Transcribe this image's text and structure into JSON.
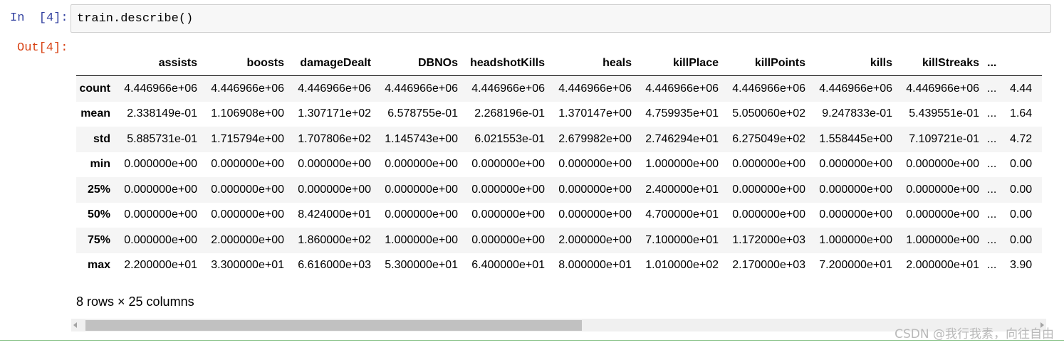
{
  "input_cell": {
    "prompt": "In  [4]:",
    "code": "train.describe()"
  },
  "output_cell": {
    "prompt": "Out[4]:"
  },
  "table": {
    "columns": [
      "assists",
      "boosts",
      "damageDealt",
      "DBNOs",
      "headshotKills",
      "heals",
      "killPlace",
      "killPoints",
      "kills",
      "killStreaks",
      "..."
    ],
    "rows": [
      {
        "index": "count",
        "values": [
          "4.446966e+06",
          "4.446966e+06",
          "4.446966e+06",
          "4.446966e+06",
          "4.446966e+06",
          "4.446966e+06",
          "4.446966e+06",
          "4.446966e+06",
          "4.446966e+06",
          "4.446966e+06",
          "...",
          "4.44"
        ]
      },
      {
        "index": "mean",
        "values": [
          "2.338149e-01",
          "1.106908e+00",
          "1.307171e+02",
          "6.578755e-01",
          "2.268196e-01",
          "1.370147e+00",
          "4.759935e+01",
          "5.050060e+02",
          "9.247833e-01",
          "5.439551e-01",
          "...",
          "1.64"
        ]
      },
      {
        "index": "std",
        "values": [
          "5.885731e-01",
          "1.715794e+00",
          "1.707806e+02",
          "1.145743e+00",
          "6.021553e-01",
          "2.679982e+00",
          "2.746294e+01",
          "6.275049e+02",
          "1.558445e+00",
          "7.109721e-01",
          "...",
          "4.72"
        ]
      },
      {
        "index": "min",
        "values": [
          "0.000000e+00",
          "0.000000e+00",
          "0.000000e+00",
          "0.000000e+00",
          "0.000000e+00",
          "0.000000e+00",
          "1.000000e+00",
          "0.000000e+00",
          "0.000000e+00",
          "0.000000e+00",
          "...",
          "0.00"
        ]
      },
      {
        "index": "25%",
        "values": [
          "0.000000e+00",
          "0.000000e+00",
          "0.000000e+00",
          "0.000000e+00",
          "0.000000e+00",
          "0.000000e+00",
          "2.400000e+01",
          "0.000000e+00",
          "0.000000e+00",
          "0.000000e+00",
          "...",
          "0.00"
        ]
      },
      {
        "index": "50%",
        "values": [
          "0.000000e+00",
          "0.000000e+00",
          "8.424000e+01",
          "0.000000e+00",
          "0.000000e+00",
          "0.000000e+00",
          "4.700000e+01",
          "0.000000e+00",
          "0.000000e+00",
          "0.000000e+00",
          "...",
          "0.00"
        ]
      },
      {
        "index": "75%",
        "values": [
          "0.000000e+00",
          "2.000000e+00",
          "1.860000e+02",
          "1.000000e+00",
          "0.000000e+00",
          "2.000000e+00",
          "7.100000e+01",
          "1.172000e+03",
          "1.000000e+00",
          "1.000000e+00",
          "...",
          "0.00"
        ]
      },
      {
        "index": "max",
        "values": [
          "2.200000e+01",
          "3.300000e+01",
          "6.616000e+03",
          "5.300000e+01",
          "6.400000e+01",
          "8.000000e+01",
          "1.010000e+02",
          "2.170000e+03",
          "7.200000e+01",
          "2.000000e+01",
          "...",
          "3.90"
        ]
      }
    ],
    "summary": "8 rows × 25 columns"
  },
  "watermark": "CSDN @我行我素，向往自由",
  "colors": {
    "in_prompt": "#303f9f",
    "out_prompt": "#d84315",
    "striped_row": "#f5f5f5",
    "cell_border": "#cfcfcf"
  },
  "icons": [
    "scroll-left-arrow-icon",
    "scroll-right-arrow-icon"
  ]
}
